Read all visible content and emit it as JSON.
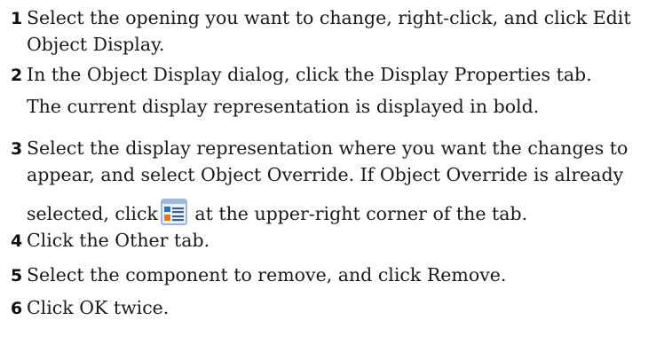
{
  "steps": [
    {
      "number": "1",
      "lines": [
        "Select the opening you want to change, right-click, and click Edit",
        "Object Display."
      ]
    },
    {
      "number": "2",
      "lines": [
        "In the Object Display dialog, click the Display Properties tab."
      ],
      "note": "The current display representation is displayed in bold."
    },
    {
      "number": "3",
      "lines": [
        "Select the display representation where you want the changes to",
        "appear, and select Object Override. If Object Override is already"
      ],
      "line3_before": "selected, click",
      "line3_after": "at the upper-right corner of the tab.",
      "icon": "edit-display-properties-icon"
    },
    {
      "number": "4",
      "lines": [
        "Click the Other tab."
      ]
    },
    {
      "number": "5",
      "lines": [
        "Select the component to remove, and click Remove."
      ]
    },
    {
      "number": "6",
      "lines": [
        "Click OK twice."
      ]
    }
  ],
  "colors": {
    "text": "#1a1a1a",
    "icon_blue": "#2a6fc4",
    "icon_orange": "#e07a1f"
  }
}
